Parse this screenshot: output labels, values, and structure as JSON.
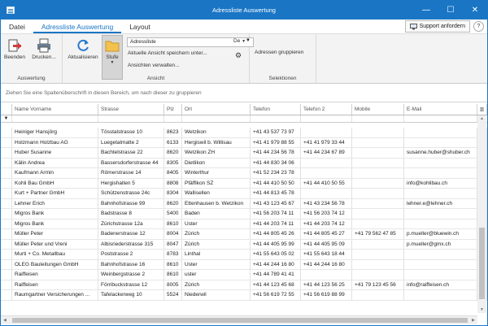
{
  "window": {
    "title": "Adressliste Auswertung",
    "minimize": "—",
    "maximize": "☐",
    "close": "✕"
  },
  "menu": {
    "tabs": [
      "Datei",
      "Adressliste Auswertung",
      "Layout"
    ],
    "support": "Support anfordern",
    "help": "?"
  },
  "ribbon": {
    "auswertung": {
      "label": "Auswertung",
      "beenden": "Beenden",
      "drucken": "Drucken..."
    },
    "ansicht": {
      "label": "Ansicht",
      "aktualisieren": "Aktualisieren",
      "stufe": "Stufe",
      "combo_value": "Adressliste",
      "save_view": "Aktuelle Ansicht speichern unter...",
      "manage_views": "Ansichten verwalten...",
      "lang": "De"
    },
    "selektionen": {
      "label": "Selektionen",
      "gruppieren": "Adressen gruppieren"
    }
  },
  "groupbar": "Ziehen Sie eine Spaltenüberschrift in diesen Bereich, um nach dieser zu gruppieren",
  "table": {
    "columns": [
      "Name Vorname",
      "Strasse",
      "Plz",
      "Ort",
      "Telefon",
      "Telefon 2",
      "Mobile",
      "E-Mail"
    ],
    "rows": [
      [
        "Heiniger Hansjörg",
        "Tösstalstrasse 10",
        "8623",
        "Wetzikon",
        "+41 43 537 73 97",
        "",
        "",
        ""
      ],
      [
        "Holzmann Holzbau AG",
        "Luegetalmatte 2",
        "6133",
        "Hergiswil b. Willisau",
        "+41 41 979 88 55",
        "+41 41 979 33 44",
        "",
        ""
      ],
      [
        "Huber Susanne",
        "Bachtelstrasse 22",
        "8620",
        "Wetzikon ZH",
        "+41 44 234 56 78",
        "+41 44 234 67 89",
        "",
        "susanne.huber@shuber.ch"
      ],
      [
        "Kälin Andrea",
        "Bassersdorferstrasse 44",
        "8305",
        "Dietlikon",
        "+41 44 830 34 06",
        "",
        "",
        ""
      ],
      [
        "Kaufmann Armin",
        "Römerstrasse 14",
        "8405",
        "Winterthur",
        "+41 52 234 23 78",
        "",
        "",
        ""
      ],
      [
        "Kohli Bau GmbH",
        "Hergishalten 5",
        "8808",
        "Pfäffikon SZ",
        "+41 44 410 50 50",
        "+41 44 410 50 55",
        "",
        "info@kohlibau.ch"
      ],
      [
        "Kurt + Partner GmbH",
        "Schützenstrasse 24c",
        "8304",
        "Wallisellen",
        "+41 44 813 45 78",
        "",
        "",
        ""
      ],
      [
        "Lehner Erich",
        "Bahnhofstrasse 99",
        "8620",
        "Ettenhausen b. Wetzikon",
        "+41 43 123 45 67",
        "+41 43 234 56 78",
        "",
        "lehner.e@lehner.ch"
      ],
      [
        "Migros Bank",
        "Badstrasse 8",
        "5400",
        "Baden",
        "+41 56 203 74 11",
        "+41 56 203 74 12",
        "",
        ""
      ],
      [
        "Migros Bank",
        "Zürichstrasse 12a",
        "8610",
        "Uster",
        "+41 44 203 74 11",
        "+41 44 203 74 12",
        "",
        ""
      ],
      [
        "Müller Peter",
        "Badenerstrasse 12",
        "8004",
        "Zürich",
        "+41 44 805 45 26",
        "+41 44 805 45 27",
        "+41 79 562 47 85",
        "p.mueller@bluewin.ch"
      ],
      [
        "Müller Peter und Vreni",
        "Albisriederstrasse 315",
        "8047",
        "Zürich",
        "+41 44 405 95 99",
        "+41 44 405 95 09",
        "",
        "p.mueller@gmx.ch"
      ],
      [
        "Murti + Co. Metallbau",
        "Poststrasse 2",
        "8783",
        "Linthal",
        "+41 55 643 05 02",
        "+41 55 643 18 44",
        "",
        ""
      ],
      [
        "OLEG Bauleitungen GmbH",
        "Bahnhofstrasse 16",
        "8610",
        "Uster",
        "+41 44 244 16 80",
        "+41 44 244 16 80",
        "",
        ""
      ],
      [
        "Raiffeisen",
        "Weinbergstrasse 2",
        "8610",
        "uster",
        "+41 44 789 41 41",
        "",
        "",
        ""
      ],
      [
        "Raiffeisen",
        "Förribuckstrasse 12",
        "8005",
        "Zürich",
        "+41 44 123 45 68",
        "+41 44 123 56 25",
        "+41 79 123 45 56",
        "info@raiffeisen.ch"
      ],
      [
        "Raumgartner Versicherungen ...",
        "Tafelackerweg 10",
        "5524",
        "Niederwil",
        "+41 56 619 72 55",
        "+41 56 619 88 99",
        "",
        ""
      ]
    ]
  }
}
